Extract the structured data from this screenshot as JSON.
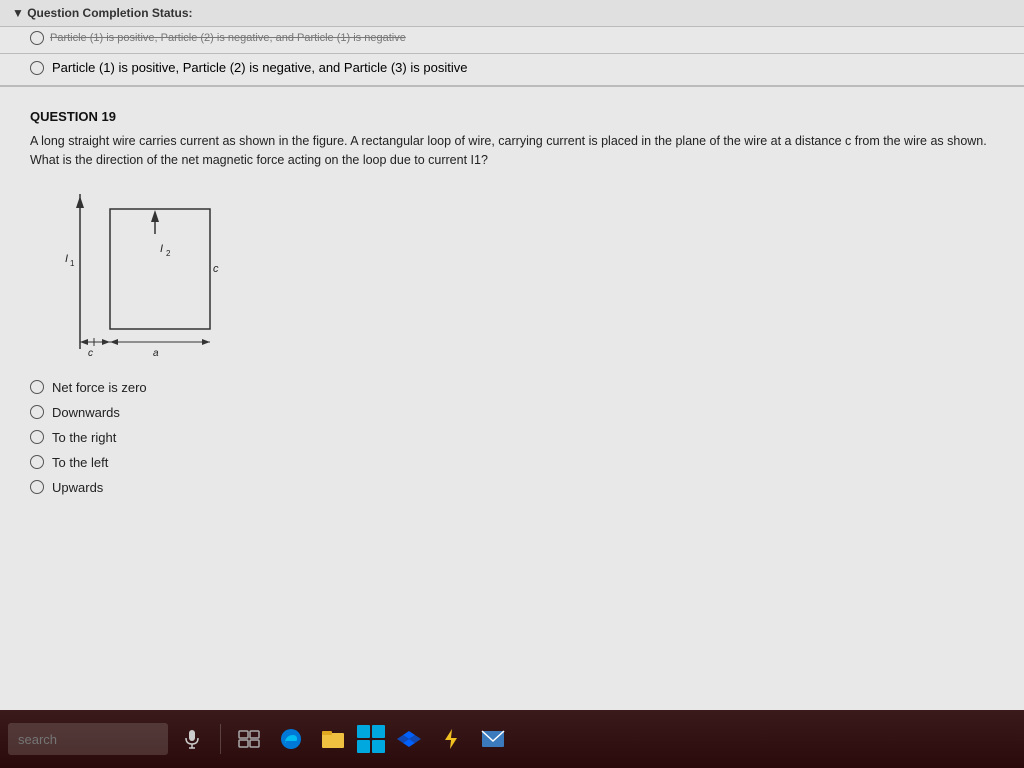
{
  "statusBar": {
    "label": "▼ Question Completion Status:",
    "strikeText": "Particle (1) is positive, Particle (2) is negative, and Particle (1) is negative"
  },
  "particleOption": {
    "text": "Particle (1)  is positive, Particle (2) is negative, and Particle (3) is positive"
  },
  "question": {
    "number": "QUESTION 19",
    "text": "A long straight wire carries current  as shown in the figure. A rectangular loop of wire, carrying current  is placed in the plane of the wire at a distance c from the wire as shown. What is the direction of the net magnetic force acting on the loop due to current I1?",
    "options": [
      {
        "id": "opt1",
        "label": "Net force is zero"
      },
      {
        "id": "opt2",
        "label": "Downwards"
      },
      {
        "id": "opt3",
        "label": "To the right"
      },
      {
        "id": "opt4",
        "label": "To the left"
      },
      {
        "id": "opt5",
        "label": "Upwards"
      }
    ]
  },
  "taskbar": {
    "searchPlaceholder": "search",
    "icons": [
      "mic",
      "taskview",
      "edge",
      "explorer",
      "windows",
      "dropbox",
      "bolt",
      "mail"
    ]
  }
}
